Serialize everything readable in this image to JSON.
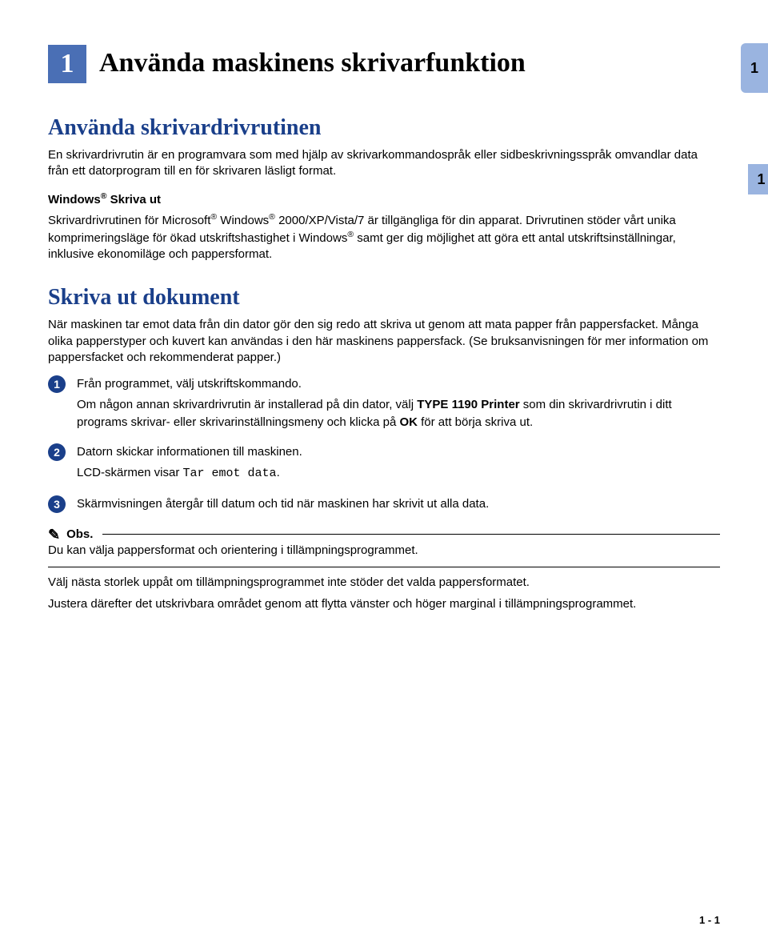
{
  "chapter": {
    "number": "1",
    "title": "Använda maskinens skrivarfunktion"
  },
  "side_tab": "1",
  "side_tab_2": "1",
  "section1": {
    "heading": "Använda skrivardrivrutinen",
    "para1_pre": "En skrivardrivrutin är en programvara som med hjälp av skrivarkommandospråk eller sidbeskrivningsspråk omvandlar data från ett datorprogram till en för skrivaren läsligt format.",
    "subhead_pre": "Windows",
    "subhead_post": " Skriva ut",
    "para2_a": "Skrivardrivrutinen för Microsoft",
    "para2_b": " Windows",
    "para2_c": " 2000/XP/Vista/7 är tillgängliga för din apparat. Drivrutinen stöder vårt unika komprimeringsläge för ökad utskriftshastighet i Windows",
    "para2_d": " samt ger dig möjlighet att göra ett antal utskriftsinställningar, inklusive ekonomiläge och pappersformat."
  },
  "section2": {
    "heading": "Skriva ut dokument",
    "para1": "När maskinen tar emot data från din dator gör den sig redo att skriva ut genom att mata papper från pappersfacket. Många olika papperstyper och kuvert kan användas i den här maskinens pappersfack. (Se bruksanvisningen för mer information om pappersfacket och rekommenderat papper.)",
    "steps": [
      {
        "bullet": "1",
        "line1": "Från programmet, välj utskriftskommando.",
        "line2_a": "Om någon annan skrivardrivrutin är installerad på din dator, välj ",
        "line2_bold1": "TYPE 1190 Printer",
        "line2_b": " som din skrivardrivrutin i ditt programs skrivar- eller skrivarinställningsmeny och klicka på ",
        "line2_bold2": "OK",
        "line2_c": " för att börja skriva ut."
      },
      {
        "bullet": "2",
        "line1": "Datorn skickar informationen till maskinen.",
        "line2_a": "LCD-skärmen visar ",
        "line2_mono": "Tar emot data",
        "line2_b": "."
      },
      {
        "bullet": "3",
        "line1": "Skärmvisningen återgår till datum och tid när maskinen har skrivit ut alla data."
      }
    ],
    "note": {
      "label": "Obs.",
      "line1": "Du kan välja pappersformat och orientering i tillämpningsprogrammet.",
      "line2": "Välj nästa storlek uppåt om tillämpningsprogrammet inte stöder det valda pappersformatet.",
      "line3": "Justera därefter det utskrivbara området genom att flytta vänster och höger marginal i tillämpningsprogrammet."
    }
  },
  "footer": {
    "page": "1 - 1"
  },
  "reg_mark": "®"
}
